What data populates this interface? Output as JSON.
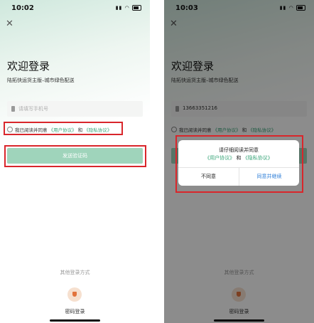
{
  "screens": [
    {
      "status_time": "10:02",
      "close_icon": "close-icon",
      "welcome": "欢迎登录",
      "subtitle": "陆拓快运货主版–城市绿色配送",
      "phone_placeholder": "请填写手机号",
      "agree_prefix": "我已阅读并同意",
      "user_agreement": "《用户协议》",
      "and": "和",
      "privacy_agreement": "《隐私协议》",
      "send_code": "发送验证码",
      "other_login": "其他登录方式",
      "password_login": "密码登录"
    },
    {
      "status_time": "10:03",
      "close_icon": "close-icon",
      "welcome": "欢迎登录",
      "subtitle": "陆拓快运货主版–城市绿色配送",
      "phone_value": "13663351216",
      "agree_prefix": "我已阅读并同意",
      "user_agreement": "《用户协议》",
      "and": "和",
      "privacy_agreement": "《隐私协议》",
      "other_login": "其他登录方式",
      "password_login": "密码登录",
      "dialog": {
        "title": "请仔细阅读并同意",
        "user_agreement": "《用户协议》",
        "and": "和",
        "privacy_agreement": "《隐私协议》",
        "disagree": "不同意",
        "agree": "同意并继续"
      }
    }
  ],
  "colors": {
    "accent": "#3aa67a",
    "button": "#9fd4bb",
    "highlight": "#d9262b",
    "link_blue": "#2f7fd8"
  }
}
